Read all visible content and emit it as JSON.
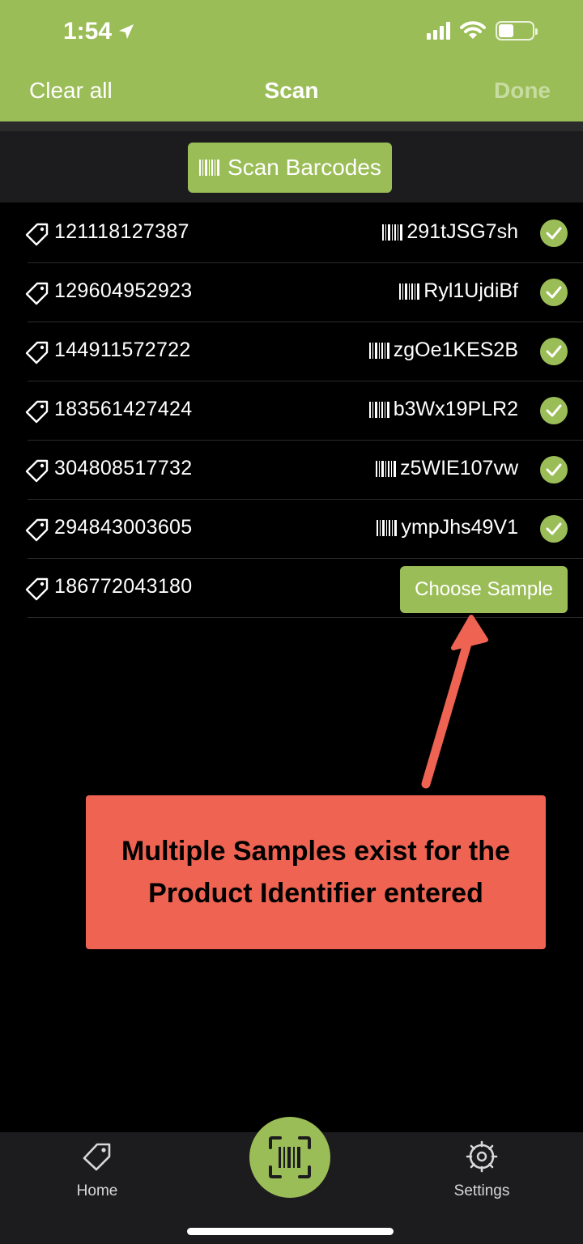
{
  "status_bar": {
    "time": "1:54"
  },
  "nav": {
    "left": "Clear all",
    "title": "Scan",
    "right": "Done"
  },
  "scan_button": {
    "label": "Scan Barcodes"
  },
  "rows": [
    {
      "product_id": "121118127387",
      "sample_code": "291tJSG7sh",
      "status": "confirmed"
    },
    {
      "product_id": "129604952923",
      "sample_code": "Ryl1UjdiBf",
      "status": "confirmed"
    },
    {
      "product_id": "144911572722",
      "sample_code": "zgOe1KES2B",
      "status": "confirmed"
    },
    {
      "product_id": "183561427424",
      "sample_code": "b3Wx19PLR2",
      "status": "confirmed"
    },
    {
      "product_id": "304808517732",
      "sample_code": "z5WIE107vw",
      "status": "confirmed"
    },
    {
      "product_id": "294843003605",
      "sample_code": "ympJhs49V1",
      "status": "confirmed"
    },
    {
      "product_id": "186772043180",
      "action_label": "Choose Sample",
      "status": "choose"
    }
  ],
  "callout": {
    "text": "Multiple Samples exist for the Product Identifier entered"
  },
  "tabbar": {
    "home": "Home",
    "settings": "Settings"
  },
  "colors": {
    "accent": "#9bbd57",
    "callout": "#ee6352",
    "background": "#000000"
  }
}
